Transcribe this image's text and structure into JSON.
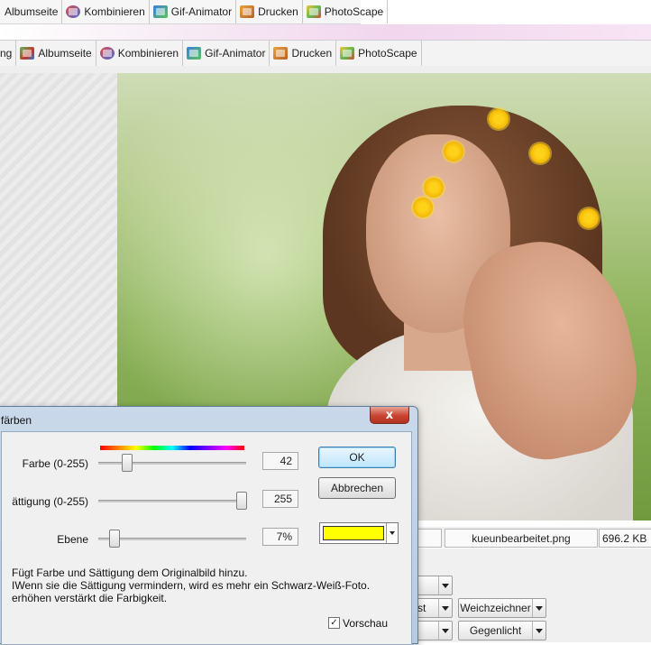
{
  "top_tabs": [
    {
      "label": "Albumseite",
      "icon": "album-icon"
    },
    {
      "label": "Kombinieren",
      "icon": "combine-icon"
    },
    {
      "label": "Gif-Animator",
      "icon": "gif-animator-icon"
    },
    {
      "label": "Drucken",
      "icon": "print-icon"
    },
    {
      "label": "PhotoScape",
      "icon": "photoscape-icon"
    }
  ],
  "second_tabs": [
    {
      "label": "ng"
    },
    {
      "label": "Albumseite",
      "icon": "album-icon"
    },
    {
      "label": "Kombinieren",
      "icon": "combine-icon"
    },
    {
      "label": "Gif-Animator",
      "icon": "gif-animator-icon"
    },
    {
      "label": "Drucken",
      "icon": "print-icon"
    },
    {
      "label": "PhotoScape",
      "icon": "photoscape-icon"
    }
  ],
  "status_bar": {
    "filename": "kueunbearbeitet.png",
    "filesize": "696.2 KB"
  },
  "controls": {
    "dropdown_2": "st",
    "dropdown_3": "Weichzeichner",
    "dropdown_5": "Gegenlicht"
  },
  "dialog": {
    "title": "färben",
    "close_glyph": "x",
    "farbe": {
      "label": "Farbe (0-255)",
      "value": "42",
      "level": 42,
      "max": 255
    },
    "saettigung": {
      "label": "ättigung (0-255)",
      "value": "255",
      "level": 255,
      "max": 255
    },
    "ebene": {
      "label": "Ebene",
      "value": "7%",
      "level": 7,
      "max": 100
    },
    "ok_label": "OK",
    "cancel_label": "Abbrechen",
    "selected_color": "#ffff00",
    "description": [
      "Fügt Farbe und Sättigung dem Originalbild hinzu.",
      "IWenn sie die Sättigung vermindern, wird es mehr ein Schwarz-Weiß-Foto.",
      "erhöhen verstärkt die Farbigkeit."
    ],
    "preview_label": "Vorschau",
    "preview_checked": true
  }
}
